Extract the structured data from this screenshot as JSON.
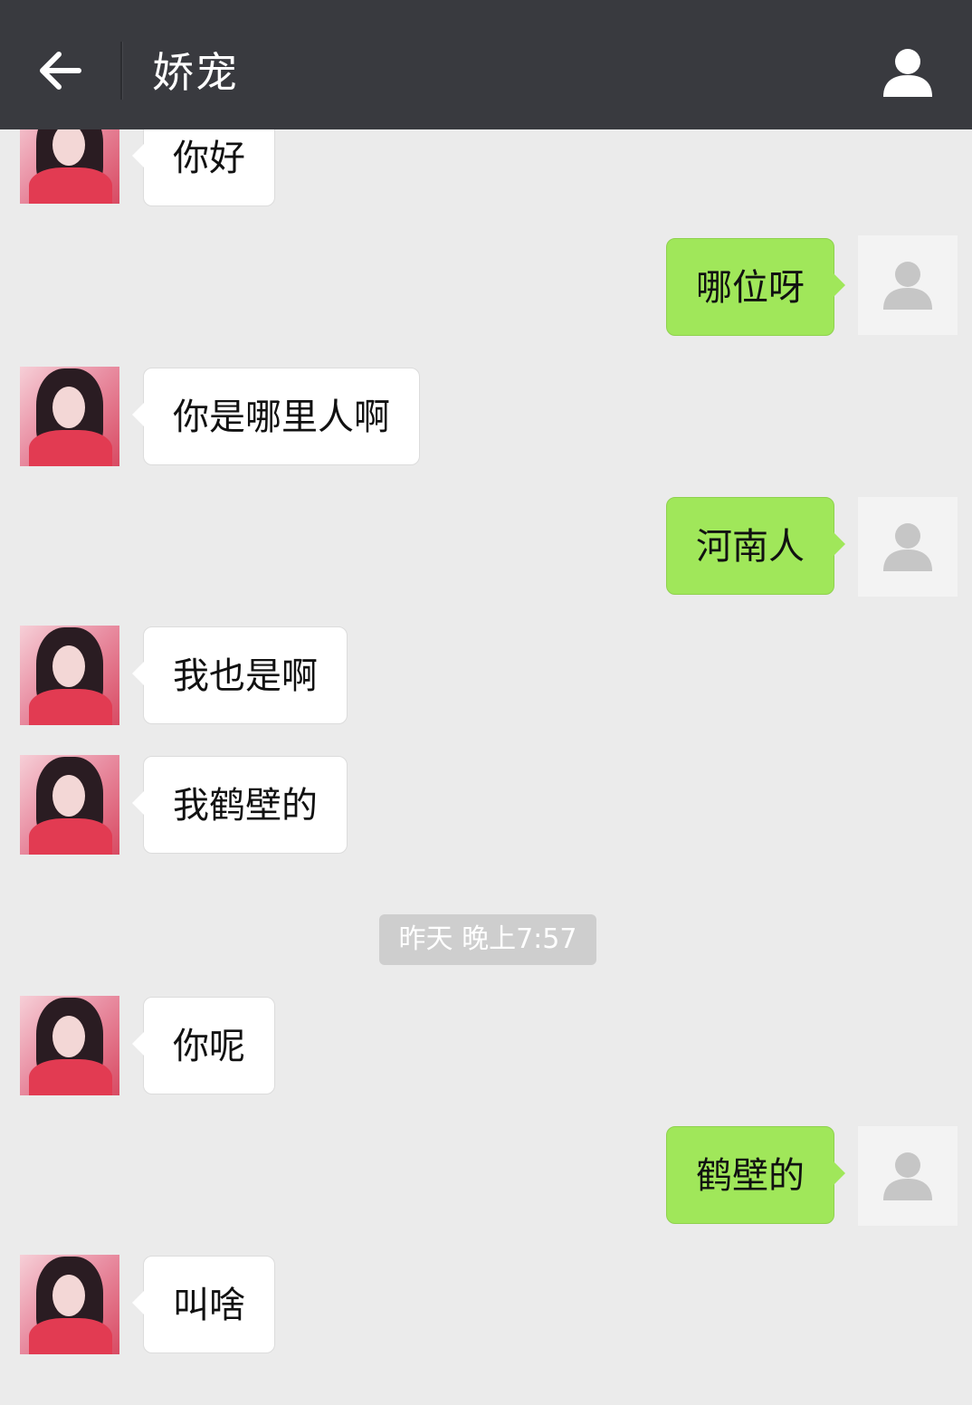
{
  "header": {
    "title": "娇宠",
    "back_icon": "arrow-left-icon",
    "profile_icon": "person-icon",
    "background": "#393a3f"
  },
  "colors": {
    "chat_background": "#ebebeb",
    "incoming_bubble": "#ffffff",
    "outgoing_bubble": "#a0e75a",
    "timestamp_badge": "#cecece"
  },
  "messages": [
    {
      "side": "in",
      "text": "你好"
    },
    {
      "side": "out",
      "text": "哪位呀"
    },
    {
      "side": "in",
      "text": "你是哪里人啊"
    },
    {
      "side": "out",
      "text": "河南人"
    },
    {
      "side": "in",
      "text": "我也是啊"
    },
    {
      "side": "in",
      "text": "我鹤壁的"
    },
    {
      "type": "timestamp",
      "text": "昨天 晚上7:57"
    },
    {
      "side": "in",
      "text": "你呢"
    },
    {
      "side": "out",
      "text": "鹤壁的"
    },
    {
      "side": "in",
      "text": "叫啥"
    }
  ]
}
